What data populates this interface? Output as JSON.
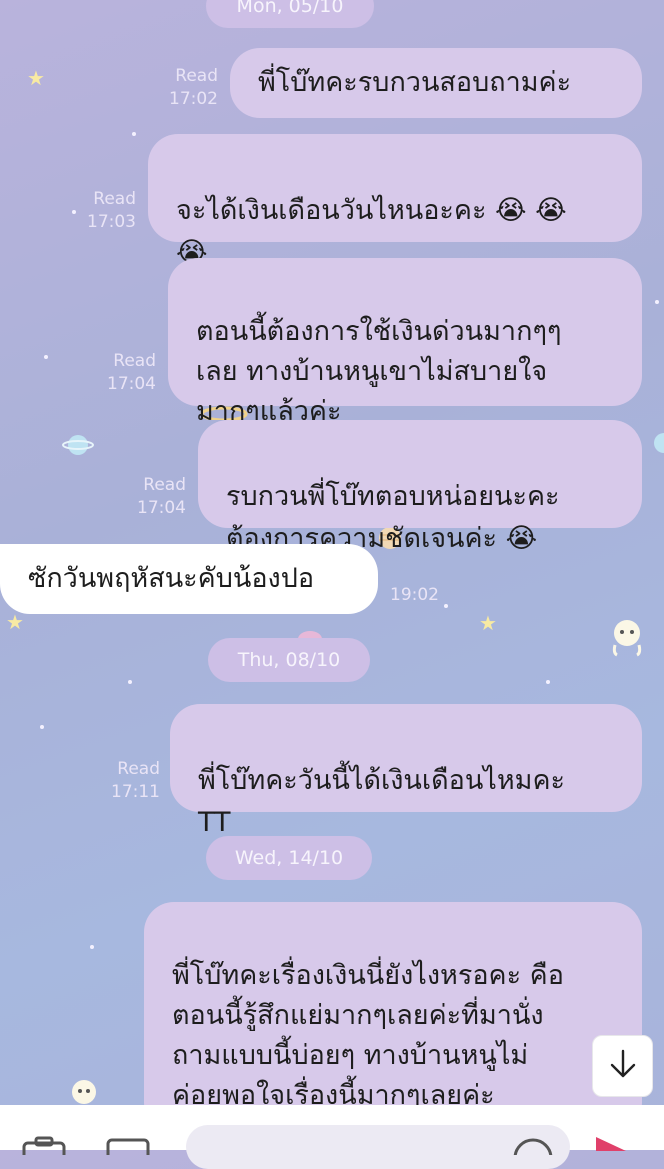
{
  "messages": [
    {
      "direction": "out",
      "text": "พี่โบ๊ทคะรบกวนสอบถามค่ะ",
      "read": "Read",
      "time": "17:02"
    },
    {
      "direction": "out",
      "text": "จะได้เงินเดือนวันไหนอะคะ 😭 😭\n😭",
      "read": "Read",
      "time": "17:03"
    },
    {
      "direction": "out",
      "text": "ตอนนี้ต้องการใช้เงินด่วนมากๆๆ\nเลย ทางบ้านหนูเขาไม่สบายใจ\nมากๆแล้วค่ะ",
      "read": "Read",
      "time": "17:04"
    },
    {
      "direction": "out",
      "text": "รบกวนพี่โบ๊ทตอบหน่อยนะคะ\nต้องการความชัดเจนค่ะ 😭",
      "read": "Read",
      "time": "17:04"
    },
    {
      "direction": "in",
      "text": "ซักวันพฤหัสนะคับน้องปอ",
      "time": "19:02"
    },
    {
      "direction": "out",
      "text": "พี่โบ๊ทคะวันนี้ได้เงินเดือนไหมคะ\nTT",
      "read": "Read",
      "time": "17:11"
    },
    {
      "direction": "out",
      "text": "พี่โบ๊ทคะเรื่องเงินนี่ยังไงหรอคะ คือ\nตอนนี้รู้สึกแย่มากๆเลยค่ะที่มานั่ง\nถามแบบนี้บ่อยๆ ทางบ้านหนูไม่\nค่อยพอใจเรื่องนี้มากๆเลยค่ะ\nลำบากใจมากๆ เงินก็ต้องใช้ จ่าย"
    }
  ],
  "date_separators": [
    "Mon, 05/10",
    "Thu, 08/10",
    "Wed, 14/10"
  ],
  "icons": {
    "scroll_down": "arrow-down-icon",
    "camera": "camera-icon",
    "gallery": "image-icon",
    "emoji": "emoji-icon",
    "send": "send-icon"
  },
  "colors": {
    "outgoing_bubble": "#d7c9ea",
    "incoming_bubble": "#ffffff",
    "meta_text": "#e9e4f6",
    "date_pill": "#cdbfe6",
    "send": "#e0406a"
  }
}
